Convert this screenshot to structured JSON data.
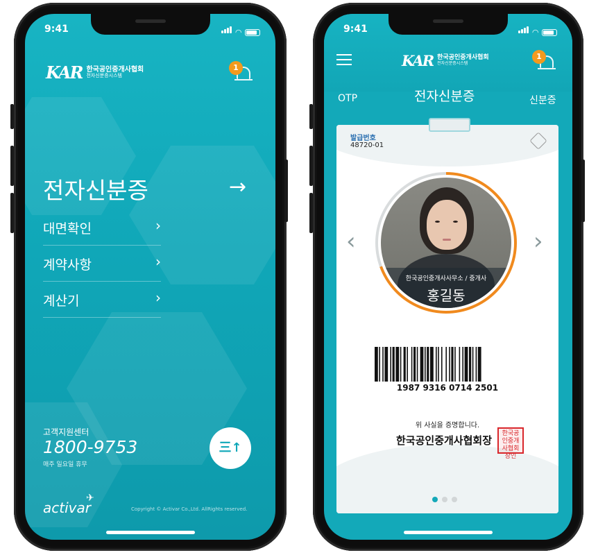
{
  "status_time": "9:41",
  "brand": {
    "logo": "KAR",
    "title": "한국공인중개사협회",
    "subtitle": "전자신분증시스템"
  },
  "notification_count": "1",
  "left": {
    "main_title": "전자신분증",
    "main_arrow": "→",
    "menu": [
      {
        "label": "대면확인",
        "chevron": "›"
      },
      {
        "label": "계약사항",
        "chevron": "›"
      },
      {
        "label": "계산기",
        "chevron": "›"
      }
    ],
    "support_label": "고객지원센터",
    "support_phone": "1800-9753",
    "support_note": "매주 일요일 휴무",
    "fab_label": "三↑",
    "footer_logo": "activar",
    "copyright": "Copyright © Activar Co.,Ltd. AllRights reserved."
  },
  "right": {
    "tabs": {
      "left": "OTP",
      "center": "전자신분증",
      "right": "신분증"
    },
    "issue_label": "발급번호",
    "issue_number": "48720-01",
    "office": "한국공인중개사사무소 / 중개사",
    "holder_name": "홍길동",
    "barcode_number": "1987 9316 0714 2501",
    "certify_text": "위 사실을 증명합니다.",
    "chairman": "한국공인중개사협회장",
    "seal_text": "한국공인중개사협회장인",
    "prev_chevron": "‹",
    "next_chevron": "›",
    "page_dots": 3,
    "active_dot": 1
  },
  "colors": {
    "teal": "#13a9b9",
    "badge": "#f39a1e",
    "ring_orange": "#f08a1e",
    "seal_red": "#d9262b"
  }
}
